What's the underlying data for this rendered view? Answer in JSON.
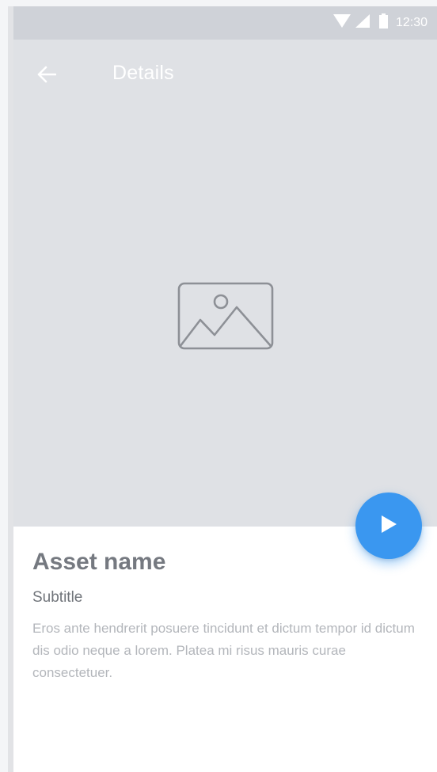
{
  "status_bar": {
    "time": "12:30",
    "icons": [
      "wifi-icon",
      "signal-icon",
      "battery-icon"
    ]
  },
  "app_bar": {
    "title": "Details",
    "back_icon": "arrow-left-icon"
  },
  "hero": {
    "placeholder_icon": "image-placeholder-icon"
  },
  "fab": {
    "icon": "play-icon",
    "color": "#3a97f0"
  },
  "details": {
    "asset_name": "Asset name",
    "subtitle": "Subtitle",
    "body": "Eros ante hendrerit posuere tincidunt et dictum tempor id dictum dis odio neque a lorem. Platea mi risus mauris curae consectetuer."
  },
  "colors": {
    "status_bar_bg": "#cfd2d8",
    "hero_bg": "#dfe1e5",
    "accent": "#3a97f0"
  }
}
